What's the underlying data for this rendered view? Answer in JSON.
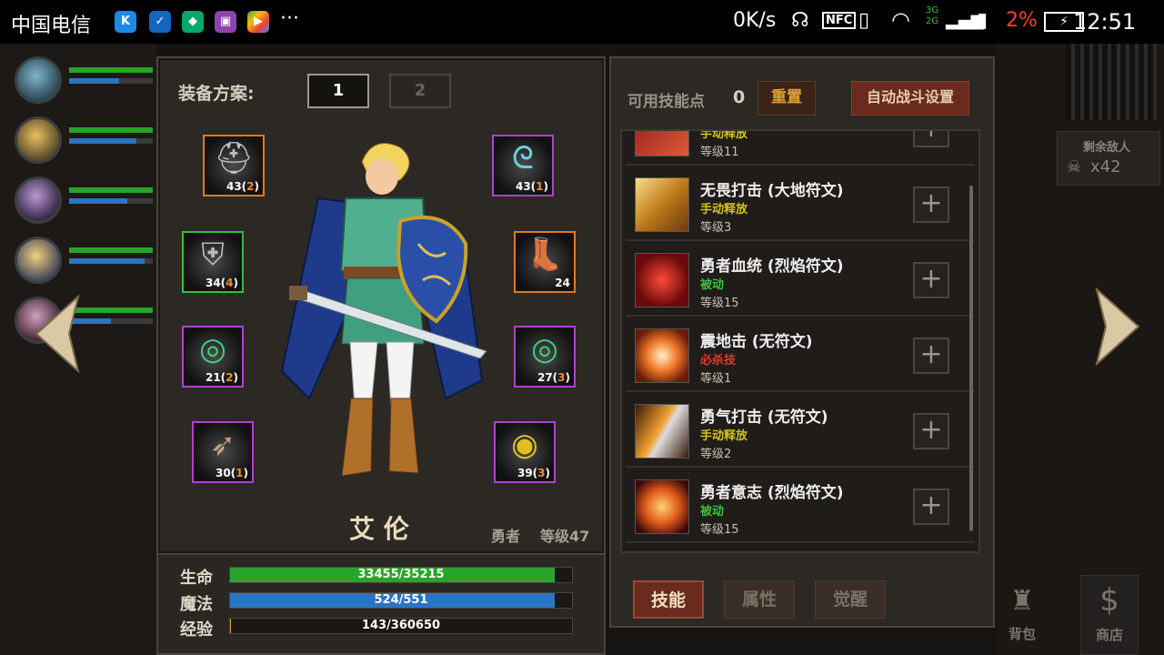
{
  "status_bar": {
    "carrier": "中国电信",
    "net_speed": "0K/s",
    "network": "3G 2G",
    "battery_pct": "2%",
    "time": "12:51",
    "icons": [
      "k-app-icon",
      "shield-check-icon",
      "vpn-shield-icon",
      "gallery-icon",
      "play-store-icon",
      "more-dots-icon",
      "headphones-icon",
      "nfc-icon",
      "vibrate-icon",
      "wifi-icon",
      "signal-icon",
      "sim-icon",
      "battery-charging-icon"
    ]
  },
  "equipment": {
    "label": "装备方案:",
    "plans": [
      "1",
      "2"
    ],
    "active_plan": "1",
    "slots": [
      {
        "name": "helmet",
        "level": "43",
        "bonus": "2",
        "rarity": "orange"
      },
      {
        "name": "necklace",
        "level": "43",
        "bonus": "1",
        "rarity": "purple"
      },
      {
        "name": "armor",
        "level": "34",
        "bonus": "4",
        "rarity": "green"
      },
      {
        "name": "boots",
        "level": "24",
        "bonus": "",
        "rarity": "orange"
      },
      {
        "name": "ring-left",
        "level": "21",
        "bonus": "2",
        "rarity": "purple"
      },
      {
        "name": "ring-right",
        "level": "27",
        "bonus": "3",
        "rarity": "purple"
      },
      {
        "name": "weapon",
        "level": "30",
        "bonus": "1",
        "rarity": "purple"
      },
      {
        "name": "shield",
        "level": "39",
        "bonus": "3",
        "rarity": "purple"
      }
    ]
  },
  "hero": {
    "name": "艾 伦",
    "class": "勇者",
    "level": "等级47"
  },
  "stats": [
    {
      "label": "生命",
      "value": "33455/35215",
      "fraction": 0.95,
      "color": "#2aa32a"
    },
    {
      "label": "魔法",
      "value": "524/551",
      "fraction": 0.95,
      "color": "#2a74c4"
    },
    {
      "label": "经验",
      "value": "143/360650",
      "fraction": 0.0004,
      "color": "#c9a227"
    }
  ],
  "skills_header": {
    "points_label": "可用技能点",
    "points": "0",
    "reset": "重置",
    "auto_battle": "自动战斗设置"
  },
  "skills": [
    {
      "name": "",
      "type": "手动释放",
      "type_color": "#d4c21a",
      "level": "等级11",
      "icon": "sword-slash-icon"
    },
    {
      "name": "无畏打击 (大地符文)",
      "type": "手动释放",
      "type_color": "#d4c21a",
      "level": "等级3",
      "icon": "fearless-strike-icon"
    },
    {
      "name": "勇者血统 (烈焰符文)",
      "type": "被动",
      "type_color": "#3fbf3f",
      "level": "等级15",
      "icon": "hero-bloodline-icon"
    },
    {
      "name": "震地击 (无符文)",
      "type": "必杀技",
      "type_color": "#e03a2a",
      "level": "等级1",
      "icon": "ground-shock-icon"
    },
    {
      "name": "勇气打击 (无符文)",
      "type": "手动释放",
      "type_color": "#d4c21a",
      "level": "等级2",
      "icon": "courage-strike-icon"
    },
    {
      "name": "勇者意志 (烈焰符文)",
      "type": "被动",
      "type_color": "#3fbf3f",
      "level": "等级15",
      "icon": "hero-will-icon"
    }
  ],
  "tabs": [
    "技能",
    "属性",
    "觉醒"
  ],
  "active_tab": "技能",
  "side": {
    "enemies_label": "剩余敌人",
    "enemies_count": "x42",
    "bag": "背包",
    "shop": "商店"
  }
}
